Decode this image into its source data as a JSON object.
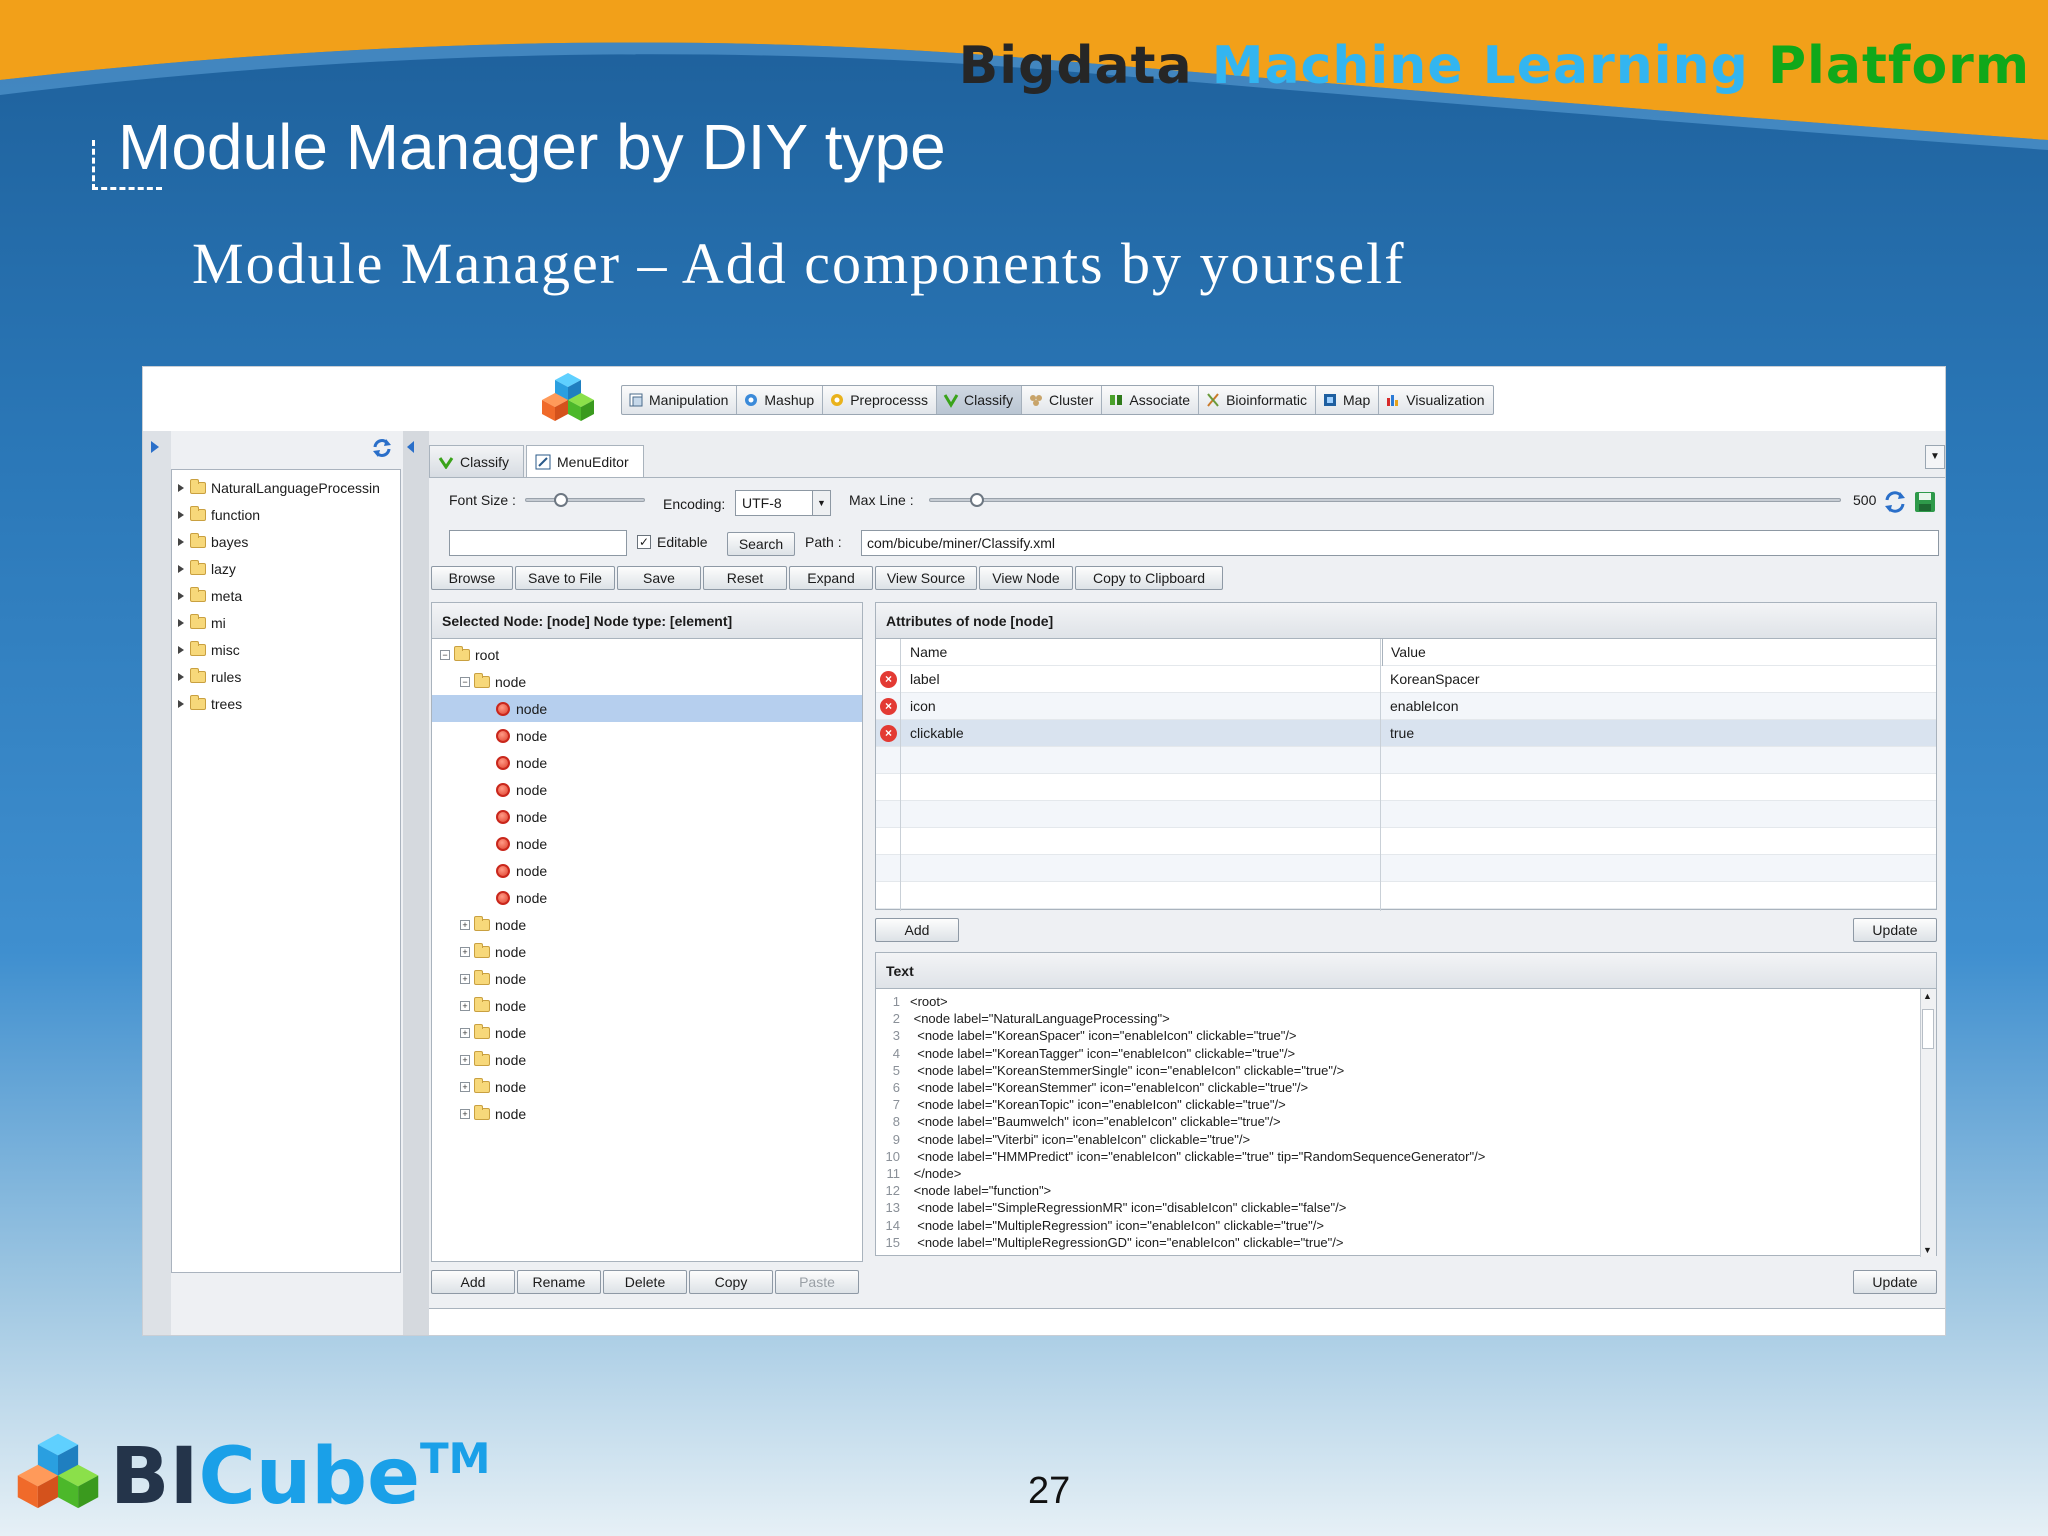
{
  "header": {
    "word1": "Bigdata",
    "word2": "Machine Learning",
    "word3": "Platform"
  },
  "slide": {
    "title": "Module Manager by DIY type",
    "subtitle": "Module Manager – Add components by yourself",
    "page_number": "27"
  },
  "footer": {
    "logo_a": "BI",
    "logo_b": "Cube",
    "logo_tm": "TM"
  },
  "toolbar": {
    "items": [
      {
        "label": "Manipulation",
        "icon": "manipulation-icon"
      },
      {
        "label": "Mashup",
        "icon": "mashup-icon"
      },
      {
        "label": "Preprocesss",
        "icon": "preprocess-icon"
      },
      {
        "label": "Classify",
        "icon": "classify-icon"
      },
      {
        "label": "Cluster",
        "icon": "cluster-icon"
      },
      {
        "label": "Associate",
        "icon": "associate-icon"
      },
      {
        "label": "Bioinformatic",
        "icon": "bioinformatic-icon"
      },
      {
        "label": "Map",
        "icon": "map-icon"
      },
      {
        "label": "Visualization",
        "icon": "visualization-icon"
      }
    ]
  },
  "left_tree": {
    "items": [
      "NaturalLanguageProcessin",
      "function",
      "bayes",
      "lazy",
      "meta",
      "mi",
      "misc",
      "rules",
      "trees"
    ]
  },
  "tabs": [
    {
      "label": "Classify"
    },
    {
      "label": "MenuEditor"
    }
  ],
  "editor": {
    "font_size_label": "Font Size :",
    "encoding_label": "Encoding:",
    "encoding_value": "UTF-8",
    "max_line_label": "Max Line :",
    "max_line_value": "500",
    "search_value": "",
    "editable_label": "Editable",
    "search_button": "Search",
    "path_label": "Path :",
    "path_value": "com/bicube/miner/Classify.xml",
    "buttons": {
      "browse": "Browse",
      "save_to_file": "Save to File",
      "save": "Save",
      "reset": "Reset",
      "expand": "Expand",
      "view_source": "View Source",
      "view_node": "View Node",
      "copy_to_clipboard": "Copy to Clipboard"
    }
  },
  "node_tree": {
    "header": "Selected Node: [node] Node type: [element]",
    "root": "root",
    "node_label": "node",
    "buttons": {
      "add": "Add",
      "rename": "Rename",
      "delete": "Delete",
      "copy": "Copy",
      "paste": "Paste"
    }
  },
  "attributes": {
    "header": "Attributes of node [node]",
    "col_name": "Name",
    "col_value": "Value",
    "rows": [
      {
        "name": "label",
        "value": "KoreanSpacer"
      },
      {
        "name": "icon",
        "value": "enableIcon"
      },
      {
        "name": "clickable",
        "value": "true"
      }
    ],
    "add_button": "Add",
    "update_button": "Update"
  },
  "text_panel": {
    "header": "Text",
    "update_button": "Update",
    "lines": [
      "<root>",
      " <node label=\"NaturalLanguageProcessing\">",
      "  <node label=\"KoreanSpacer\" icon=\"enableIcon\" clickable=\"true\"/>",
      "  <node label=\"KoreanTagger\" icon=\"enableIcon\" clickable=\"true\"/>",
      "  <node label=\"KoreanStemmerSingle\" icon=\"enableIcon\" clickable=\"true\"/>",
      "  <node label=\"KoreanStemmer\" icon=\"enableIcon\" clickable=\"true\"/>",
      "  <node label=\"KoreanTopic\" icon=\"enableIcon\" clickable=\"true\"/>",
      "  <node label=\"Baumwelch\" icon=\"enableIcon\" clickable=\"true\"/>",
      "  <node label=\"Viterbi\" icon=\"enableIcon\" clickable=\"true\"/>",
      "  <node label=\"HMMPredict\" icon=\"enableIcon\" clickable=\"true\" tip=\"RandomSequenceGenerator\"/>",
      " </node>",
      " <node label=\"function\">",
      "  <node label=\"SimpleRegressionMR\" icon=\"disableIcon\" clickable=\"false\"/>",
      "  <node label=\"MultipleRegression\" icon=\"enableIcon\" clickable=\"true\"/>",
      "  <node label=\"MultipleRegressionGD\" icon=\"enableIcon\" clickable=\"true\"/>"
    ]
  }
}
